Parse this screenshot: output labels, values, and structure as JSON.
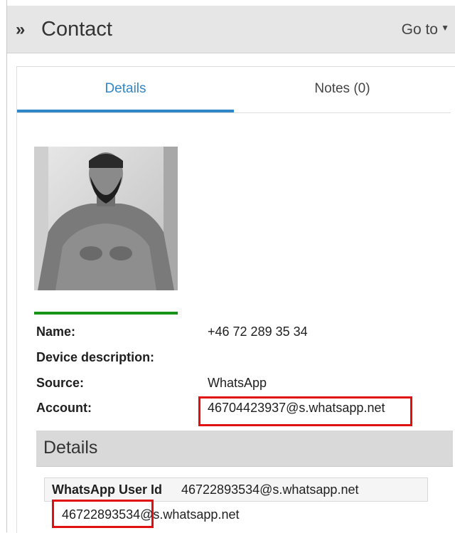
{
  "header": {
    "title": "Contact",
    "goto_label": "Go to"
  },
  "tabs": [
    {
      "label": "Details",
      "active": true
    },
    {
      "label": "Notes (0)",
      "active": false
    }
  ],
  "contact": {
    "name_label": "Name:",
    "name_value": "+46 72 289 35 34",
    "device_label": "Device description:",
    "device_value": "",
    "source_label": "Source:",
    "source_value": "WhatsApp",
    "account_label": "Account:",
    "account_value": "46704423937@s.whatsapp.net"
  },
  "details": {
    "section_title": "Details",
    "user_id_label": "WhatsApp User Id",
    "user_id_value": "46722893534@s.whatsapp.net",
    "extra_value": "46722893534@s.whatsapp.net"
  },
  "colors": {
    "tab_active": "#2f86c9",
    "avatar_bar": "#179317",
    "highlight": "#e01010"
  }
}
